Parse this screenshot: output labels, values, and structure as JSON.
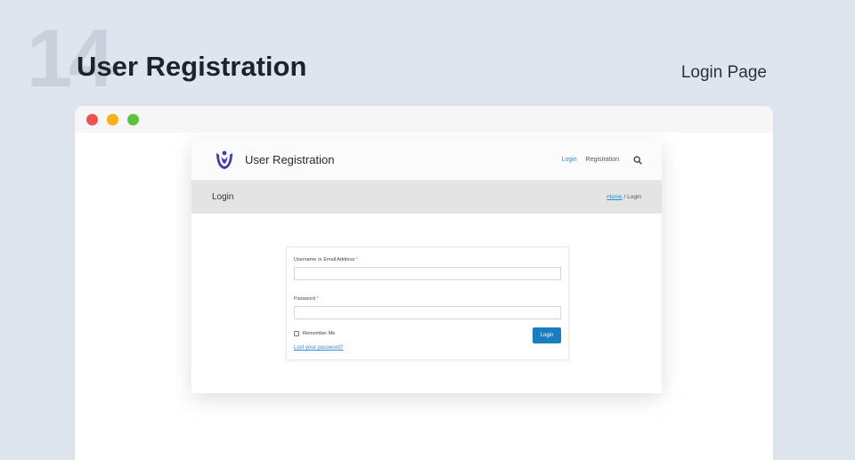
{
  "slide": {
    "number": "14",
    "title": "User Registration",
    "caption": "Login Page"
  },
  "window_controls": [
    "close-dot",
    "minimize-dot",
    "maximize-dot"
  ],
  "colors": {
    "background": "#dfe5ef",
    "accent": "#1a7dbd",
    "link": "#2f8ad0",
    "required": "#e24b4b",
    "logo": "#3f3fa6"
  },
  "site": {
    "name": "User Registration",
    "logo_icon": "user-registration-logo-icon",
    "nav": {
      "login": "Login",
      "registration": "Registration",
      "search_icon": "search-icon"
    },
    "page_title": "Login",
    "breadcrumb": {
      "home": "Home",
      "separator": " / ",
      "current": "Login"
    }
  },
  "login_form": {
    "username_label": "Username or Email Address",
    "password_label": "Password",
    "required_marker": "*",
    "username_value": "",
    "password_value": "",
    "remember_label": "Remember Me",
    "remember_checked": false,
    "login_button": "Login",
    "lost_password": "Lost your password?"
  }
}
